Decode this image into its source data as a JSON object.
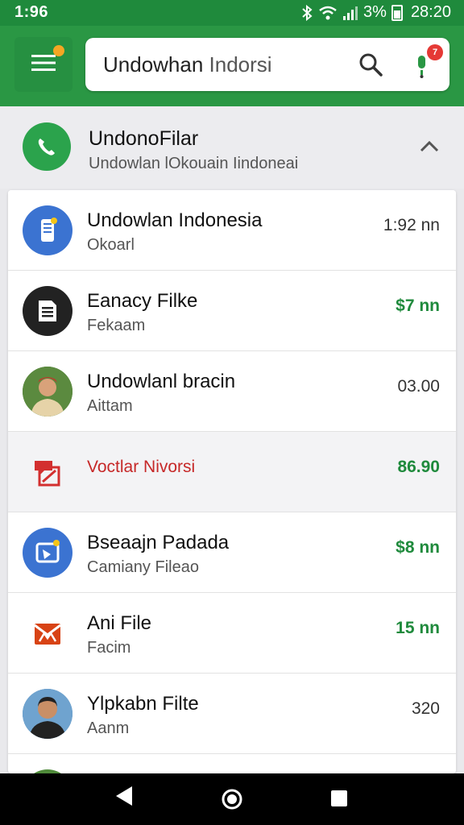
{
  "status": {
    "time": "1:96",
    "battery_text": "3%",
    "clock": "28:20"
  },
  "search": {
    "query_bold": "Undowhan",
    "query_rest": " Indorsi",
    "badge": "7"
  },
  "header": {
    "title": "UndonoFilar",
    "subtitle": "Undowlan lOkouain Iindoneai"
  },
  "rows": [
    {
      "name": "Undowlan Indonesia",
      "sub": "Okoarl",
      "value": "1:92 nn",
      "green": false,
      "icon": "phone-app-icon"
    },
    {
      "name": "Eanacy Filke",
      "sub": "Fekaam",
      "value": "$7 nn",
      "green": true,
      "icon": "document-icon"
    },
    {
      "name": "Undowlanl bracin",
      "sub": "Aittam",
      "value": "03.00",
      "green": false,
      "icon": "person-avatar"
    },
    {
      "name": "Voctlar Nivorsi",
      "sub": "",
      "value": "86.90",
      "green": true,
      "icon": "flag-icon"
    },
    {
      "name": "Bseaajn Padada",
      "sub": "Camiany Fileao",
      "value": "$8 nn",
      "green": true,
      "icon": "photo-app-icon"
    },
    {
      "name": "Ani File",
      "sub": "Facim",
      "value": "15 nn",
      "green": true,
      "icon": "mail-icon"
    },
    {
      "name": "Ylpkabn Filte",
      "sub": "Aanm",
      "value": "320",
      "green": false,
      "icon": "person-avatar"
    }
  ],
  "colors": {
    "brand_green": "#2a9744",
    "accent_red": "#c62828",
    "value_green": "#1f8a3c"
  }
}
